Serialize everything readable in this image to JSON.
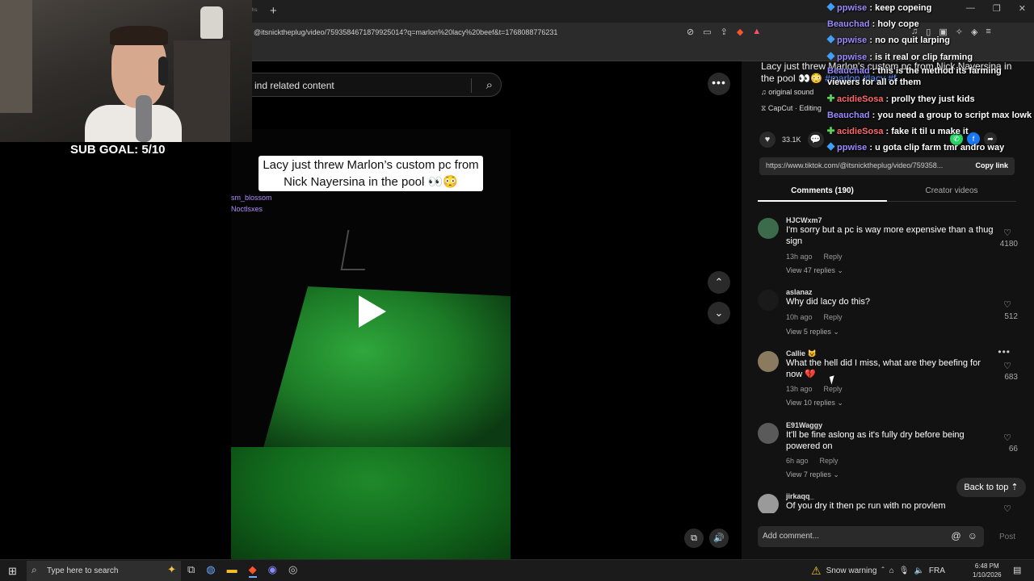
{
  "browser": {
    "url": "tiktok.com/@itsnicktheplug/video/7593584671879925014?q=marlon%20lacy%20beef&t=1768088776231",
    "url_visible": "@itsnicktheplug/video/7593584671879925014?q=marlon%20lacy%20beef&t=1768088776231",
    "new_tab_icon": "+"
  },
  "overlay": {
    "sub_goal": "SUB GOAL: 5/10"
  },
  "tiktok": {
    "search_placeholder": "ind related content",
    "video": {
      "caption": "Lacy just threw Marlon’s custom pc from Nick Nayersina in the pool 👀😳",
      "overlay_names": [
        "sm_blossom",
        "Noctlsxes"
      ]
    },
    "post": {
      "description": "Lacy just threw Marlon's custom pc from Nick Nayersina in the pool 👀😳",
      "tags": "#marlon #lacy #f...",
      "sound": "original sound",
      "capcut": "CapCut · Editing",
      "likes": "33.1K",
      "link_url": "https://www.tiktok.com/@itsnicktheplug/video/759358...",
      "copy_link": "Copy link"
    },
    "tabs": [
      {
        "label": "Comments (190)"
      },
      {
        "label": "Creator videos"
      }
    ],
    "comments": [
      {
        "user": "HJCWxm7",
        "text": "I'm sorry but a pc is way more expensive than a thug sign",
        "time": "13h ago",
        "reply": "Reply",
        "replies": "View 47 replies",
        "likes": "4180"
      },
      {
        "user": "aslanaz",
        "text": "Why did lacy do this?",
        "time": "10h ago",
        "reply": "Reply",
        "replies": "View 5 replies",
        "likes": "512"
      },
      {
        "user": "Callie 😺",
        "text": "What the hell did I miss, what are they beefing for now 💔",
        "time": "13h ago",
        "reply": "Reply",
        "replies": "View 10 replies",
        "likes": "683"
      },
      {
        "user": "E91Waggy",
        "text": "It'll be fine aslong as it's fully dry before being powered on",
        "time": "6h ago",
        "reply": "Reply",
        "replies": "View 7 replies",
        "likes": "66"
      },
      {
        "user": "jirkaqq_",
        "text": "Of you dry it then pc run with no provlem"
      }
    ],
    "back_to_top": "Back to top",
    "add_comment": "Add comment...",
    "post_label": "Post"
  },
  "chat": [
    {
      "badge": "blue",
      "user": "ppwise",
      "user_color": "#9b8cff",
      "msg": "keep copeing"
    },
    {
      "badge": "",
      "user": "Beauchad",
      "user_color": "#9b8cff",
      "msg": "holy cope"
    },
    {
      "badge": "blue",
      "user": "ppwise",
      "user_color": "#9b8cff",
      "msg": "no no quit larping"
    },
    {
      "badge": "blue",
      "user": "ppwise",
      "user_color": "#9b8cff",
      "msg": "is it real or clip farming"
    },
    {
      "badge": "",
      "user": "Beauchad",
      "user_color": "#9b8cff",
      "msg": "this is the method its farming viewers for all of them",
      "wrap": true
    },
    {
      "badge": "green",
      "user": "acidieSosa",
      "user_color": "#ff6b6b",
      "msg": "prolly they just kids"
    },
    {
      "badge": "",
      "user": "Beauchad",
      "user_color": "#9b8cff",
      "msg": "you need a group to script max lowk"
    },
    {
      "badge": "green",
      "user": "acidieSosa",
      "user_color": "#ff6b6b",
      "msg": "fake it til u make it"
    },
    {
      "badge": "blue",
      "user": "ppwise",
      "user_color": "#9b8cff",
      "msg": "u gota clip farm tmr andro way"
    }
  ],
  "taskbar": {
    "search_placeholder": "Type here to search",
    "weather": "Snow warning",
    "lang": "FRA",
    "time": "6:48 PM",
    "date": "1/10/2026"
  }
}
